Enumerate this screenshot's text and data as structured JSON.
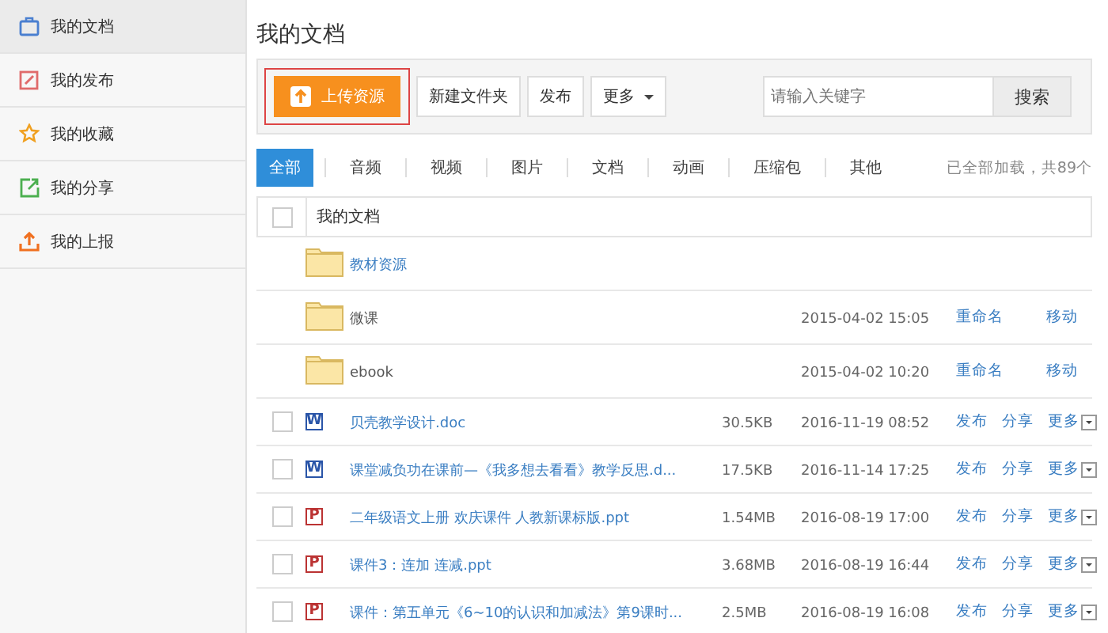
{
  "sidebar": {
    "items": [
      {
        "label": "我的文档",
        "selected": true
      },
      {
        "label": "我的发布",
        "selected": false
      },
      {
        "label": "我的收藏",
        "selected": false
      },
      {
        "label": "我的分享",
        "selected": false
      },
      {
        "label": "我的上报",
        "selected": false
      }
    ]
  },
  "page_title": "我的文档",
  "toolbar": {
    "upload_button": "上传资源",
    "buttons": [
      "新建文件夹",
      "发布"
    ],
    "more_button": "更多",
    "search": {
      "placeholder": "请输入关键字",
      "button": "搜索"
    }
  },
  "tabs": [
    {
      "label": "全部",
      "selected": true
    },
    {
      "label": "音频",
      "selected": false
    },
    {
      "label": "视频",
      "selected": false
    },
    {
      "label": "图片",
      "selected": false
    },
    {
      "label": "文档",
      "selected": false
    },
    {
      "label": "动画",
      "selected": false
    },
    {
      "label": "压缩包",
      "selected": false
    },
    {
      "label": "其他",
      "selected": false
    }
  ],
  "load_status": "已全部加载，共89个",
  "select_all": {
    "checked": false
  },
  "breadcrumb": "我的文档",
  "rows": [
    {
      "kind": "folder",
      "name": "教材资源",
      "actions": []
    },
    {
      "kind": "folder",
      "name": "微课",
      "date": "2015-04-02 15:05",
      "actions": [
        "重命名",
        "移动"
      ]
    },
    {
      "kind": "folder",
      "name": "ebook",
      "date": "2015-04-02 10:20",
      "actions": [
        "重命名",
        "移动"
      ]
    },
    {
      "kind": "word",
      "checked": false,
      "badge": "W",
      "name": "贝壳教学设计.doc",
      "size": "30.5KB",
      "date": "2016-11-19 08:52",
      "actions": [
        "发布",
        "分享",
        "更多"
      ]
    },
    {
      "kind": "word",
      "checked": false,
      "badge": "W",
      "name": "课堂减负功在课前—《我多想去看看》教学反思.d...",
      "size": "17.5KB",
      "date": "2016-11-14 17:25",
      "actions": [
        "发布",
        "分享",
        "更多"
      ]
    },
    {
      "kind": "ppt",
      "checked": false,
      "badge": "P",
      "name": "二年级语文上册 欢庆课件 人教新课标版.ppt",
      "size": "1.54MB",
      "date": "2016-08-19 17:00",
      "actions": [
        "发布",
        "分享",
        "更多"
      ]
    },
    {
      "kind": "ppt",
      "checked": false,
      "badge": "P",
      "name": "课件3：连加 连减.ppt",
      "size": "3.68MB",
      "date": "2016-08-19 16:44",
      "actions": [
        "发布",
        "分享",
        "更多"
      ]
    },
    {
      "kind": "ppt",
      "checked": false,
      "badge": "P",
      "name": "课件：第五单元《6~10的认识和加减法》第9课时...",
      "size": "2.5MB",
      "date": "2016-08-19 16:08",
      "actions": [
        "发布",
        "分享",
        "更多"
      ]
    }
  ]
}
